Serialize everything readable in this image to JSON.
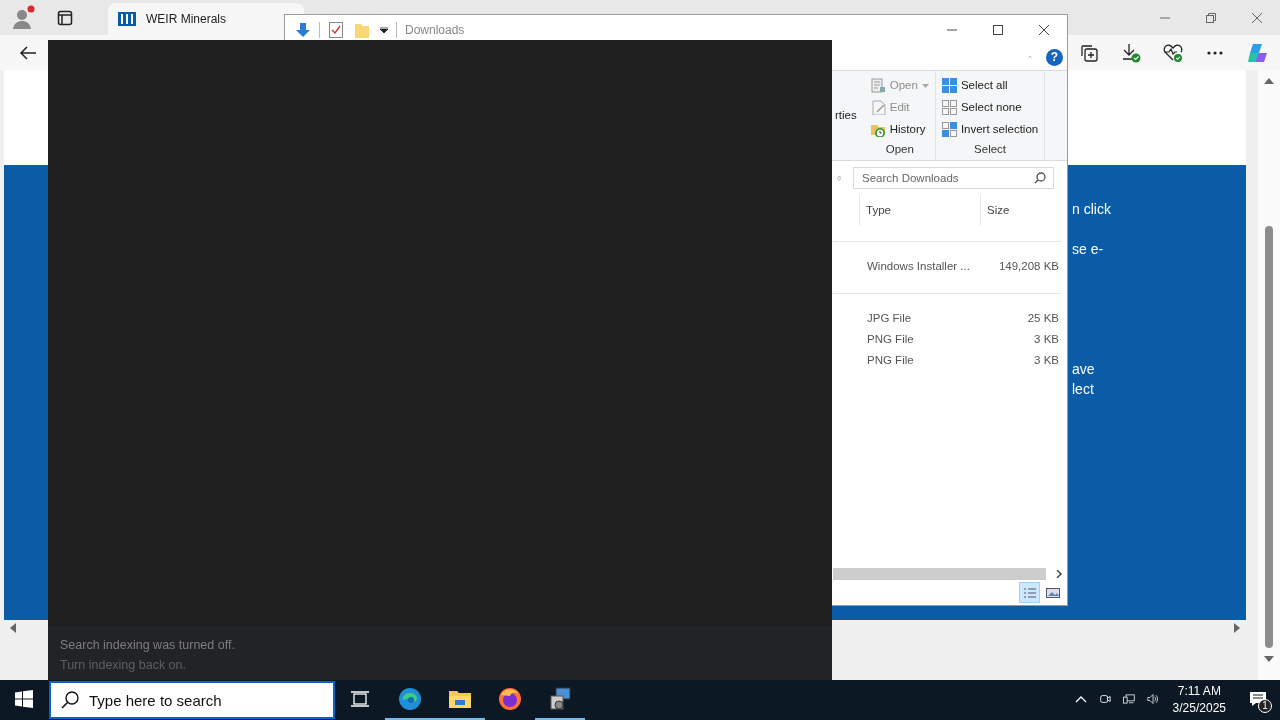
{
  "browser": {
    "tab": {
      "title": "WEIR Minerals",
      "selected": true
    },
    "paragraphs": [
      [
        "n click"
      ],
      [
        "se e-"
      ],
      [
        "ave",
        "lect"
      ]
    ]
  },
  "explorer": {
    "title": "Downloads",
    "help_label": "?",
    "ribbon_fragment": "rties",
    "ribbon_groups": [
      {
        "label": "Open",
        "items": [
          {
            "label": "Open",
            "kind": "open",
            "disabled": true,
            "dropdown": true
          },
          {
            "label": "Edit",
            "kind": "edit",
            "disabled": true,
            "dropdown": false
          },
          {
            "label": "History",
            "kind": "history",
            "disabled": false,
            "dropdown": false
          }
        ]
      },
      {
        "label": "Select",
        "items": [
          {
            "label": "Select all",
            "kind": "select-all",
            "disabled": false,
            "dropdown": false
          },
          {
            "label": "Select none",
            "kind": "select-none",
            "disabled": false,
            "dropdown": false
          },
          {
            "label": "Invert selection",
            "kind": "invert",
            "disabled": false,
            "dropdown": false
          }
        ]
      }
    ],
    "search_placeholder": "Search Downloads",
    "columns": [
      "Type",
      "Size"
    ],
    "groups": [
      {
        "rows": [
          {
            "type": "Windows Installer ...",
            "size": "149,208 KB"
          }
        ]
      },
      {
        "rows": [
          {
            "type": "JPG File",
            "size": "25 KB"
          },
          {
            "type": "PNG File",
            "size": "3 KB"
          },
          {
            "type": "PNG File",
            "size": "3 KB"
          }
        ]
      }
    ],
    "views": [
      {
        "kind": "details",
        "selected": true
      },
      {
        "kind": "tiles",
        "selected": false
      }
    ]
  },
  "search_panel": {
    "notice": "Search indexing was turned off.",
    "link": "Turn indexing back on."
  },
  "taskbar": {
    "search_placeholder": "Type here to search",
    "apps": [
      {
        "kind": "edge",
        "running": true
      },
      {
        "kind": "explorer",
        "running": true
      },
      {
        "kind": "firefox",
        "running": false
      },
      {
        "kind": "installer",
        "running": true
      }
    ],
    "time": "7:11 AM",
    "date": "3/25/2025",
    "notifications": "1"
  }
}
